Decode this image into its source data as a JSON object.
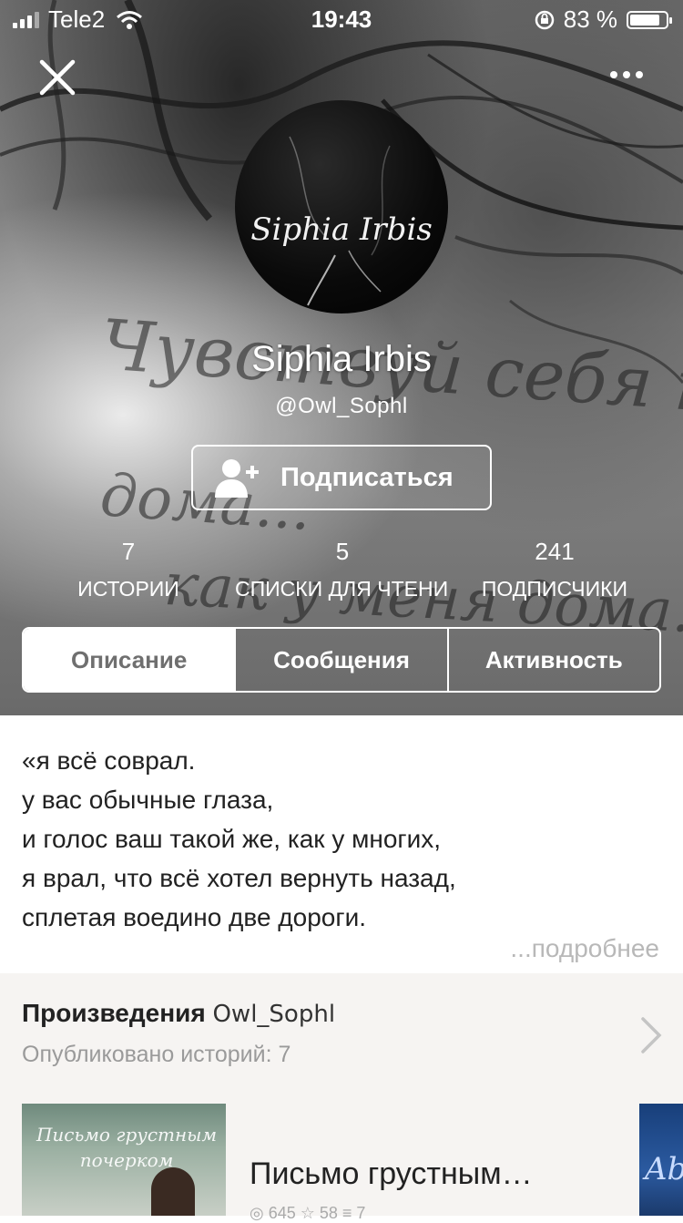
{
  "status_bar": {
    "carrier": "Tele2",
    "time": "19:43",
    "battery": "83 %",
    "battery_level": 0.83
  },
  "header": {
    "close_icon": "close-icon",
    "more_icon": "more-dots-icon"
  },
  "cover": {
    "script_lines": [
      "Чувствуй себя как",
      "дома...",
      "как у меня дома."
    ]
  },
  "profile": {
    "avatar_text": "Siphia Irbis",
    "name": "Siphia Irbis",
    "handle": "@Owl_Sophl",
    "follow_label": "Подписаться",
    "follow_icon": "add-user-icon"
  },
  "stats": [
    {
      "value": "7",
      "label": "ИСТОРИИ"
    },
    {
      "value": "5",
      "label": "СПИСКИ ДЛЯ ЧТЕНИ"
    },
    {
      "value": "241",
      "label": "ПОДПИСЧИКИ"
    }
  ],
  "tabs": [
    {
      "label": "Описание",
      "active": true
    },
    {
      "label": "Сообщения",
      "active": false
    },
    {
      "label": "Активность",
      "active": false
    }
  ],
  "description": {
    "lines": [
      "«я всё соврал.",
      "у вас обычные глаза,",
      "и голос ваш такой же, как у многих,",
      "я врал, что всё хотел вернуть назад,",
      "сплетая воедино две дороги."
    ],
    "more_label": "...подробнее"
  },
  "works": {
    "title": "Произведения",
    "author": "Owl_Sophl",
    "subtitle": "Опубликовано историй: 7",
    "chevron_icon": "chevron-right-icon",
    "stories": [
      {
        "cover_text": "Письмо грустным почерком",
        "title": "Письмо грустным…",
        "meta": "◎ 645   ☆ 58   ≡ 7"
      }
    ],
    "next_cover_text": "Ab"
  }
}
